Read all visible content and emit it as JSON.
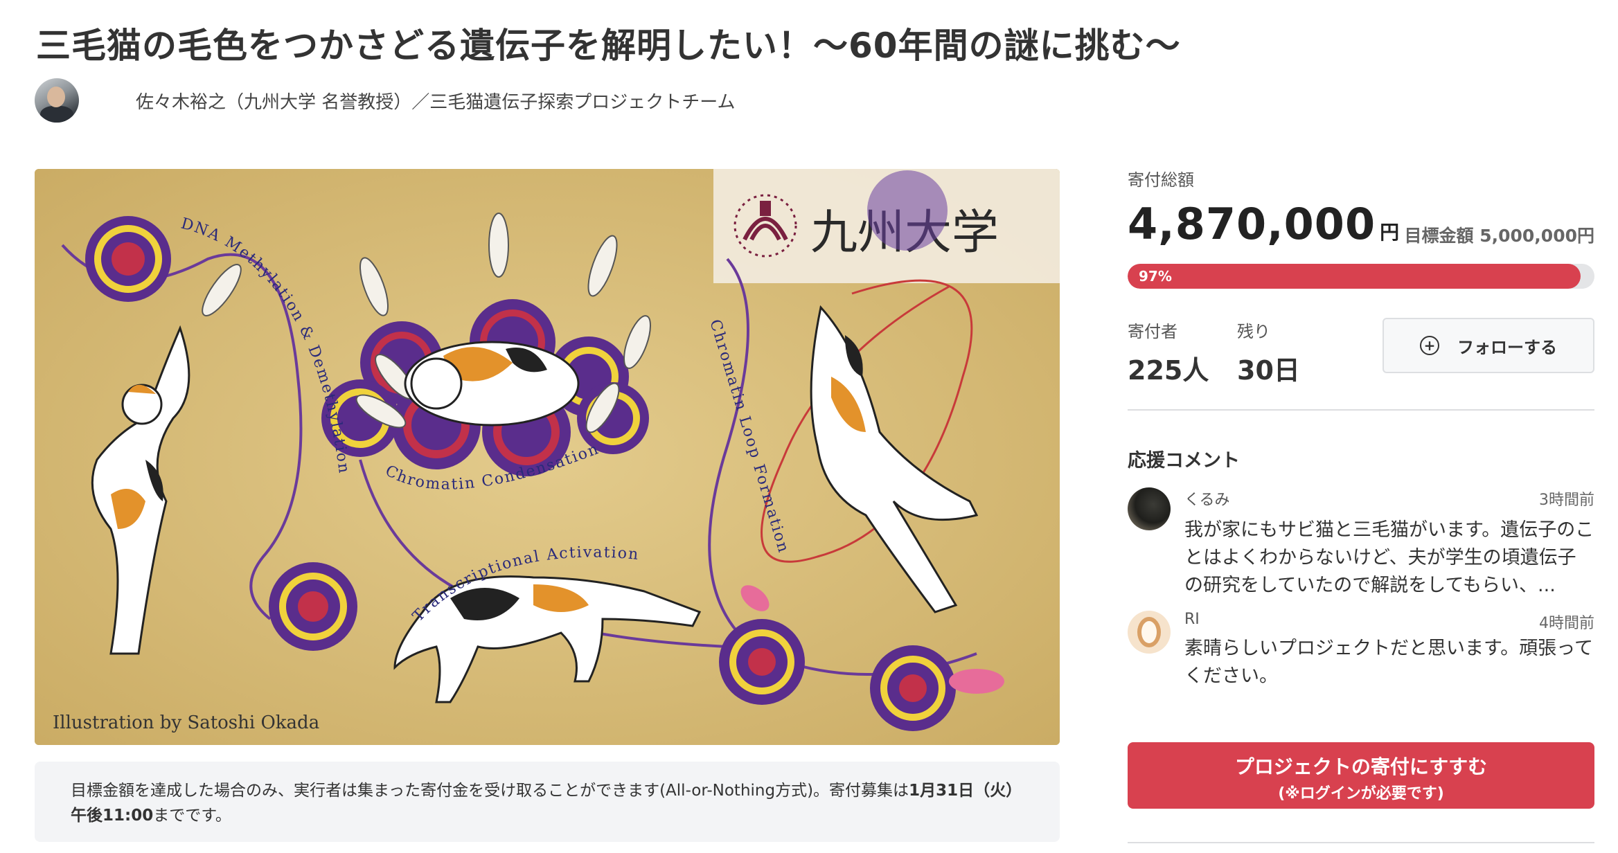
{
  "project": {
    "title": "三毛猫の毛色をつかさどる遺伝子を解明したい！〜60年間の謎に挑む〜",
    "author": "佐々木裕之（九州大学 名誉教授）／三毛猫遺伝子探索プロジェクトチーム"
  },
  "hero": {
    "logo_text": "九州大学",
    "labels": {
      "dna": "DNA Methylation & Demethylation",
      "chromatin_condensation": "Chromatin Condensation",
      "chromatin_loop": "Chromatin Loop Formation",
      "transcriptional": "Transcriptional Activation"
    },
    "credit": "Illustration by Satoshi Okada"
  },
  "note": {
    "text_part1": "目標金額を達成した場合のみ、実行者は集まった寄付金を受け取ることができます(All-or-Nothing方式)。寄付募集は",
    "deadline_bold": "1月31日（火）午後11:00",
    "text_part2": "までです。"
  },
  "funding": {
    "total_label": "寄付総額",
    "total_amount": "4,870,000",
    "currency": "円",
    "goal_text": "目標金額 5,000,000円",
    "progress_label": "97%",
    "progress": 0.97,
    "supporters_label": "寄付者",
    "supporters_value": "225人",
    "remaining_label": "残り",
    "remaining_value": "30日",
    "follow_label": "フォローする"
  },
  "comments": {
    "section_title": "応援コメント",
    "items": [
      {
        "name": "くるみ",
        "time": "3時間前",
        "text": "我が家にもサビ猫と三毛猫がいます。遺伝子のことはよくわからないけど、夫が学生の頃遺伝子の研究をしていたので解説をしてもらい、..."
      },
      {
        "name": "RI",
        "time": "4時間前",
        "text": "素晴らしいプロジェクトだと思います。頑張ってください。"
      }
    ]
  },
  "cta": {
    "line1": "プロジェクトの寄付にすすむ",
    "line2": "(※ログインが必要です)"
  },
  "colors": {
    "accent_red": "#d8414f",
    "progress_track": "#e4e5e7",
    "note_bg": "#f3f4f6",
    "hero_bg": "#d9bf7b"
  }
}
